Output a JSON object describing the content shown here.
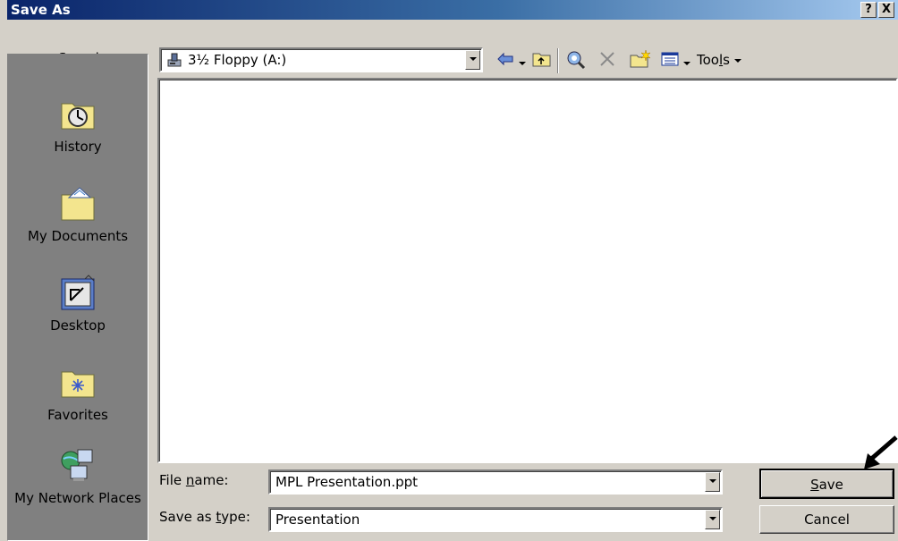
{
  "window": {
    "title": "Save As",
    "help_label": "?",
    "close_label": "X"
  },
  "toolbar": {
    "save_in_label": "Save in:",
    "location_value": "3½ Floppy (A:)",
    "tools_label": "Tools"
  },
  "places": [
    {
      "label": "History",
      "icon": "history-icon"
    },
    {
      "label": "My Documents",
      "icon": "my-documents-icon"
    },
    {
      "label": "Desktop",
      "icon": "desktop-icon"
    },
    {
      "label": "Favorites",
      "icon": "favorites-icon"
    },
    {
      "label": "My Network Places",
      "icon": "network-places-icon"
    }
  ],
  "form": {
    "file_name_label": "File name:",
    "file_name_value": "MPL Presentation.ppt",
    "save_as_type_label": "Save as type:",
    "save_as_type_value": "Presentation"
  },
  "buttons": {
    "save_label": "Save",
    "cancel_label": "Cancel"
  },
  "colors": {
    "title_start": "#0a246a",
    "title_end": "#a6caf0",
    "face": "#d4d0c8",
    "places_bg": "#808080"
  }
}
